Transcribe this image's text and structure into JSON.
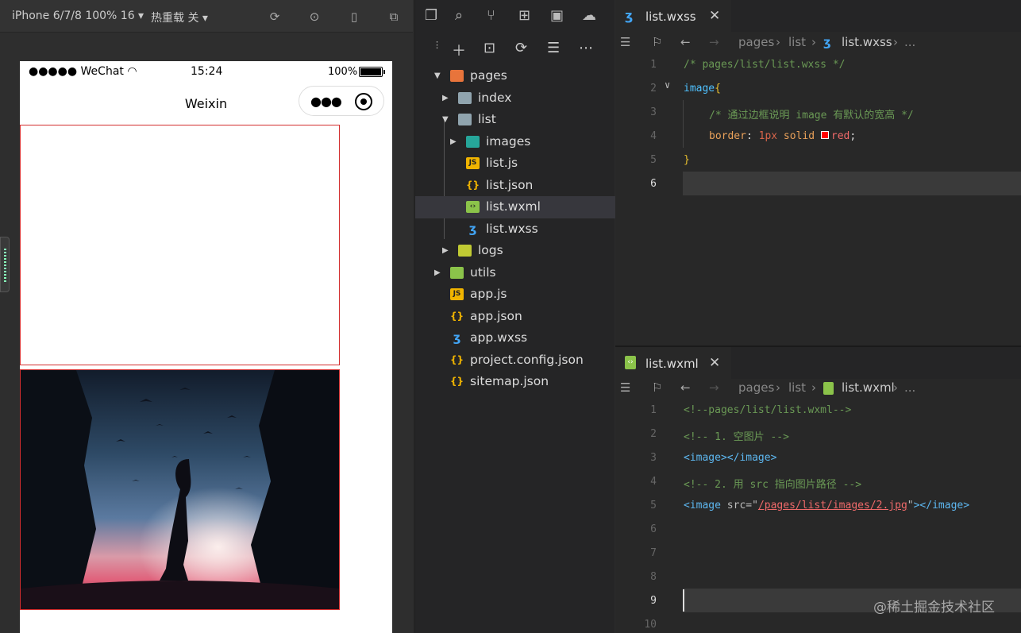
{
  "simulator": {
    "device": "iPhone 6/7/8 100% 16",
    "hot_reload": "热重载 关",
    "status_left": "●●●●● WeChat",
    "status_time": "15:24",
    "status_battery": "100%",
    "nav_title": "Weixin"
  },
  "explorer": {
    "items": [
      {
        "label": "pages",
        "icon": "folder-open-icon",
        "color": "#e8743b",
        "indent": 0,
        "arrow": "▼"
      },
      {
        "label": "index",
        "icon": "folder-icon",
        "color": "#90a4ae",
        "indent": 1,
        "arrow": "▶"
      },
      {
        "label": "list",
        "icon": "folder-open-icon",
        "color": "#90a4ae",
        "indent": 1,
        "arrow": "▼"
      },
      {
        "label": "images",
        "icon": "image-folder-icon",
        "color": "#26a69a",
        "indent": 2,
        "arrow": "▶"
      },
      {
        "label": "list.js",
        "icon": "js-file-icon",
        "color": "#f0b400",
        "indent": 2,
        "arrow": ""
      },
      {
        "label": "list.json",
        "icon": "json-file-icon",
        "color": "#f0b400",
        "indent": 2,
        "arrow": ""
      },
      {
        "label": "list.wxml",
        "icon": "wxml-file-icon",
        "color": "#8bc34a",
        "indent": 2,
        "arrow": ""
      },
      {
        "label": "list.wxss",
        "icon": "wxss-file-icon",
        "color": "#42a5f5",
        "indent": 2,
        "arrow": ""
      },
      {
        "label": "logs",
        "icon": "folder-icon",
        "color": "#c0ca33",
        "indent": 1,
        "arrow": "▶"
      },
      {
        "label": "utils",
        "icon": "folder-icon",
        "color": "#8bc34a",
        "indent": 0,
        "arrow": "▶"
      },
      {
        "label": "app.js",
        "icon": "js-file-icon",
        "color": "#f0b400",
        "indent": 0,
        "arrow": ""
      },
      {
        "label": "app.json",
        "icon": "json-file-icon",
        "color": "#f0b400",
        "indent": 0,
        "arrow": ""
      },
      {
        "label": "app.wxss",
        "icon": "wxss-file-icon",
        "color": "#42a5f5",
        "indent": 0,
        "arrow": ""
      },
      {
        "label": "project.config.json",
        "icon": "json-file-icon",
        "color": "#f0b400",
        "indent": 0,
        "arrow": ""
      },
      {
        "label": "sitemap.json",
        "icon": "json-file-icon",
        "color": "#f0b400",
        "indent": 0,
        "arrow": ""
      }
    ]
  },
  "editor_top": {
    "tab": "list.wxss",
    "crumb_pages": "pages",
    "crumb_list": "list",
    "crumb_file": "list.wxss",
    "crumb_more": "...",
    "line_numbers": [
      "1",
      "2",
      "3",
      "4",
      "5",
      "6"
    ],
    "l1": "/* pages/list/list.wxss */",
    "l2_sel": "image",
    "l2_br": "{",
    "l3": "/* 通过边框说明 image 有默认的宽高 */",
    "l4_prop": "border",
    "l4_colon": ": ",
    "l4_num": "1px",
    "l4_solid": " solid ",
    "l4_red": "red",
    "l4_semi": ";",
    "l5": "}"
  },
  "editor_bottom": {
    "tab": "list.wxml",
    "crumb_pages": "pages",
    "crumb_list": "list",
    "crumb_file": "list.wxml",
    "crumb_more": "...",
    "line_numbers": [
      "1",
      "2",
      "3",
      "4",
      "5",
      "6",
      "7",
      "8",
      "9",
      "10"
    ],
    "l1": "<!--pages/list/list.wxml-->",
    "l2": "<!-- 1. 空图片 -->",
    "l3": "<image></image>",
    "l4": "<!-- 2. 用 src 指向图片路径 -->",
    "l5_open": "<image ",
    "l5_attr": "src=\"",
    "l5_str": "/pages/list/images/2.jpg",
    "l5_q": "\"",
    "l5_close": "></image>"
  },
  "watermark": "@稀土掘金技术社区"
}
